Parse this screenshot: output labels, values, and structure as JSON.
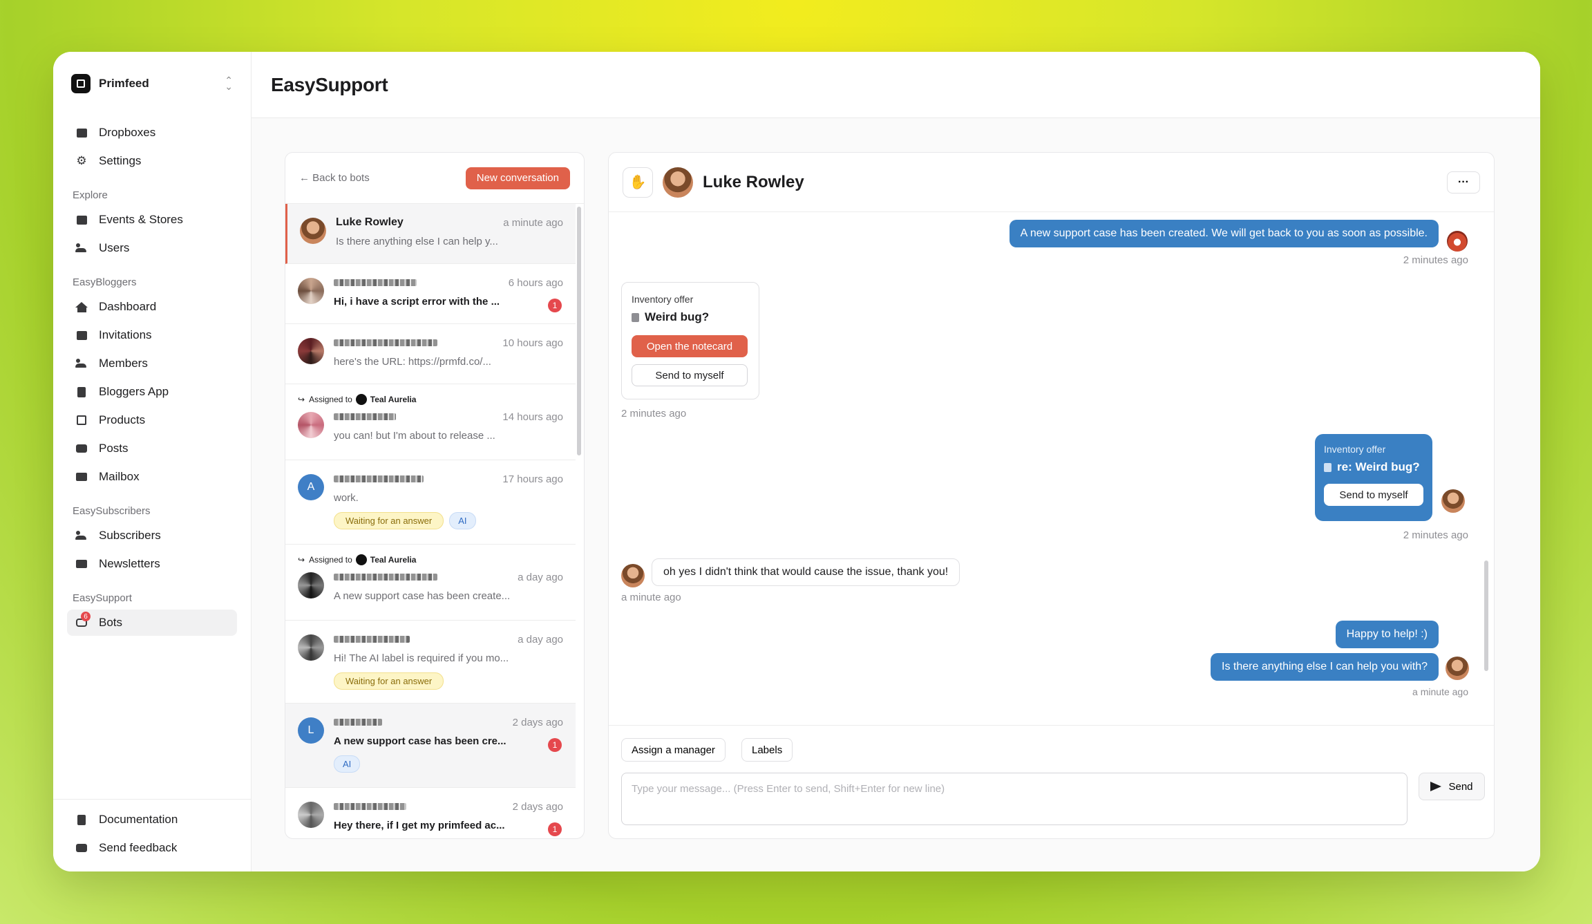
{
  "brand": {
    "name": "Primfeed"
  },
  "sidebar": {
    "top_items": [
      {
        "label": "Dropboxes"
      },
      {
        "label": "Settings"
      }
    ],
    "sections": [
      {
        "title": "Explore",
        "items": [
          {
            "label": "Events & Stores"
          },
          {
            "label": "Users"
          }
        ]
      },
      {
        "title": "EasyBloggers",
        "items": [
          {
            "label": "Dashboard"
          },
          {
            "label": "Invitations"
          },
          {
            "label": "Members"
          },
          {
            "label": "Bloggers App"
          },
          {
            "label": "Products"
          },
          {
            "label": "Posts"
          },
          {
            "label": "Mailbox"
          }
        ]
      },
      {
        "title": "EasySubscribers",
        "items": [
          {
            "label": "Subscribers"
          },
          {
            "label": "Newsletters"
          }
        ]
      },
      {
        "title": "EasySupport",
        "items": [
          {
            "label": "Bots",
            "badge": "6"
          }
        ]
      }
    ],
    "bottom_items": [
      {
        "label": "Documentation"
      },
      {
        "label": "Send feedback"
      }
    ]
  },
  "header": {
    "title": "EasySupport"
  },
  "list": {
    "back_label": "← Back to bots",
    "new_conversation_label": "New conversation",
    "conversations": [
      {
        "name": "Luke Rowley",
        "time": "a minute ago",
        "preview": "Is there anything else I can help y..."
      },
      {
        "time": "6 hours ago",
        "preview": "Hi, i have a script error with the ...",
        "unread": "1"
      },
      {
        "time": "10 hours ago",
        "preview": "here's the URL: https://prmfd.co/..."
      },
      {
        "assigned_prefix": "Assigned to",
        "assigned_name": "Teal Aurelia",
        "time": "14 hours ago",
        "preview": "you can! but I'm about to release ..."
      },
      {
        "letter": "A",
        "time": "17 hours ago",
        "preview": "work.",
        "tag_wait": "Waiting for an answer",
        "tag_ai": "AI"
      },
      {
        "assigned_prefix": "Assigned to",
        "assigned_name": "Teal Aurelia",
        "time": "a day ago",
        "preview": "A new support case has been create..."
      },
      {
        "time": "a day ago",
        "preview": "Hi! The AI label is required if you mo...",
        "tag_wait": "Waiting for an answer"
      },
      {
        "letter": "L",
        "time": "2 days ago",
        "preview": "A new support case has been cre...",
        "unread": "1",
        "tag_ai": "AI"
      },
      {
        "time": "2 days ago",
        "preview": "Hey there, if I get my primfeed ac...",
        "unread": "1"
      }
    ]
  },
  "chat": {
    "contact_name": "Luke Rowley",
    "more_label": "···",
    "messages": {
      "m1": "A new support case has been created. We will get back to you as soon as possible.",
      "m1_time": "2 minutes ago",
      "card1_title": "Inventory offer",
      "card1_sub": "Weird bug?",
      "card1_btn_open": "Open the notecard",
      "card1_btn_send": "Send to myself",
      "card1_time": "2 minutes ago",
      "card2_title": "Inventory offer",
      "card2_sub": "re: Weird bug?",
      "card2_btn_send": "Send to myself",
      "card2_time": "2 minutes ago",
      "m3": "oh yes I didn't think that would cause the issue, thank you!",
      "m3_time": "a minute ago",
      "m4": "Happy to help! :)",
      "m5": "Is there anything else I can help you with?",
      "m5_time": "a minute ago"
    },
    "composer": {
      "assign_label": "Assign a manager",
      "labels_label": "Labels",
      "placeholder": "Type your message... (Press Enter to send, Shift+Enter for new line)",
      "send_label": "Send"
    }
  },
  "colors": {
    "accent_orange": "#e0614a",
    "bubble_blue": "#3a80c3",
    "badge_red": "#e5484d"
  }
}
